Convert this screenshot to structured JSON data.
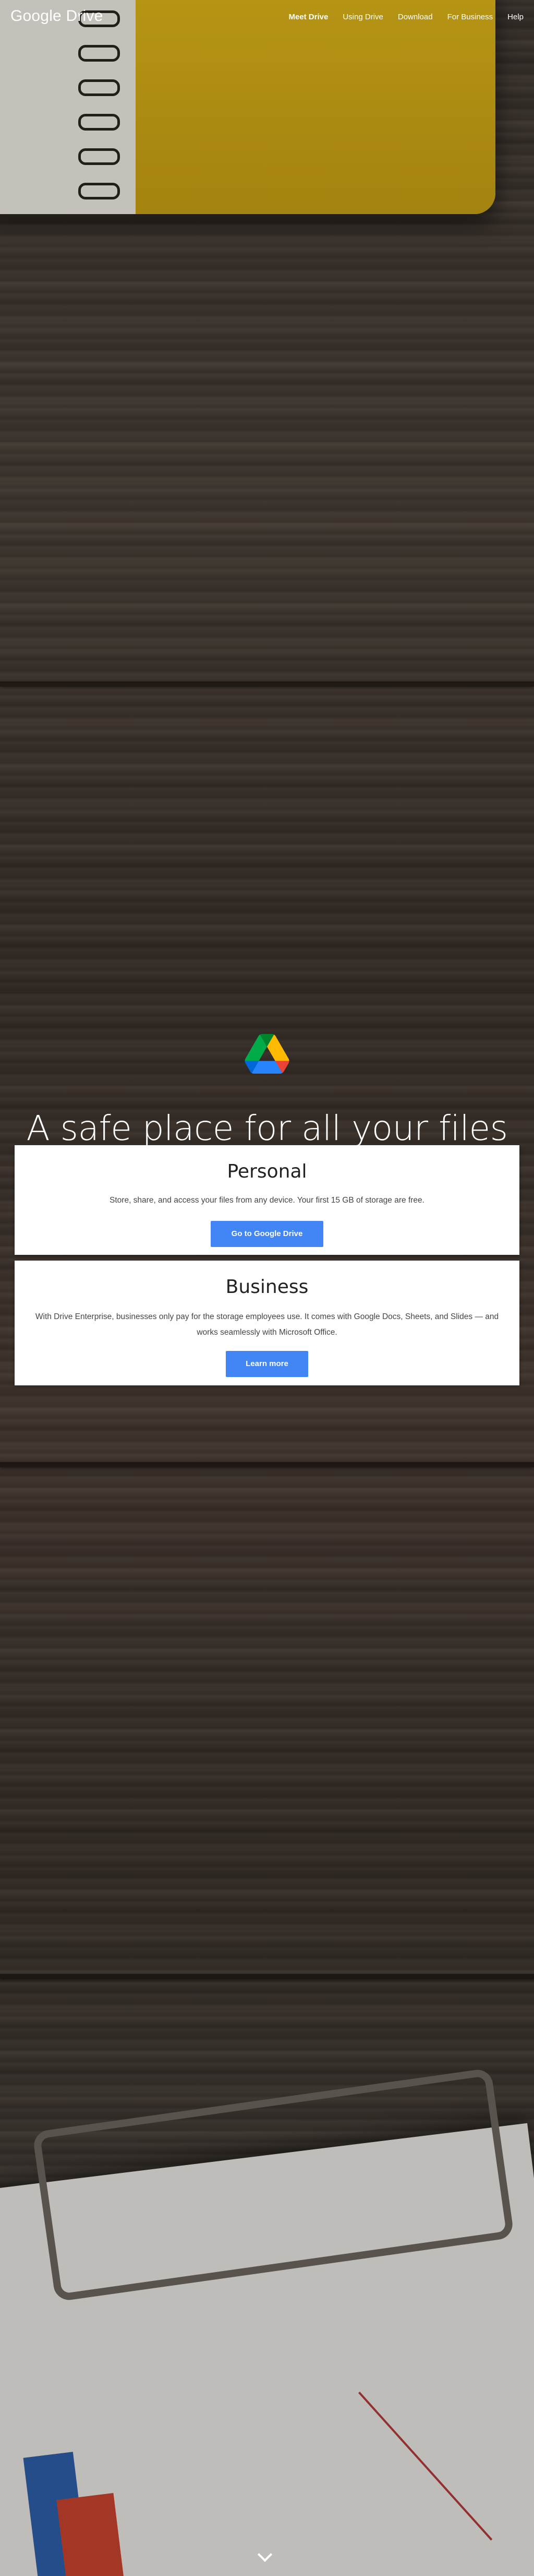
{
  "header": {
    "logo": "Google Drive",
    "nav": [
      {
        "label": "Meet Drive",
        "active": true
      },
      {
        "label": "Using Drive",
        "active": false
      },
      {
        "label": "Download",
        "active": false
      },
      {
        "label": "For Business",
        "active": false
      },
      {
        "label": "Help",
        "active": false
      }
    ]
  },
  "hero": {
    "icon": "google-drive-icon",
    "title": "A safe place for all your files"
  },
  "personal": {
    "title": "Personal",
    "body": "Store, share, and access your files from any device. Your first 15 GB of storage are free.",
    "button": "Go to Google Drive"
  },
  "business": {
    "title": "Business",
    "body": "With Drive Enterprise, businesses only pay for the storage employees use. It comes with Google Docs, Sheets, and Slides — and works seamlessly with Microsoft Office.",
    "button": "Learn more"
  },
  "scroll": {
    "icon": "chevron-down-icon"
  },
  "colors": {
    "button": "#4285f4",
    "drive_green": "#1ea362",
    "drive_yellow": "#ffcd40",
    "drive_blue": "#4688f4"
  }
}
